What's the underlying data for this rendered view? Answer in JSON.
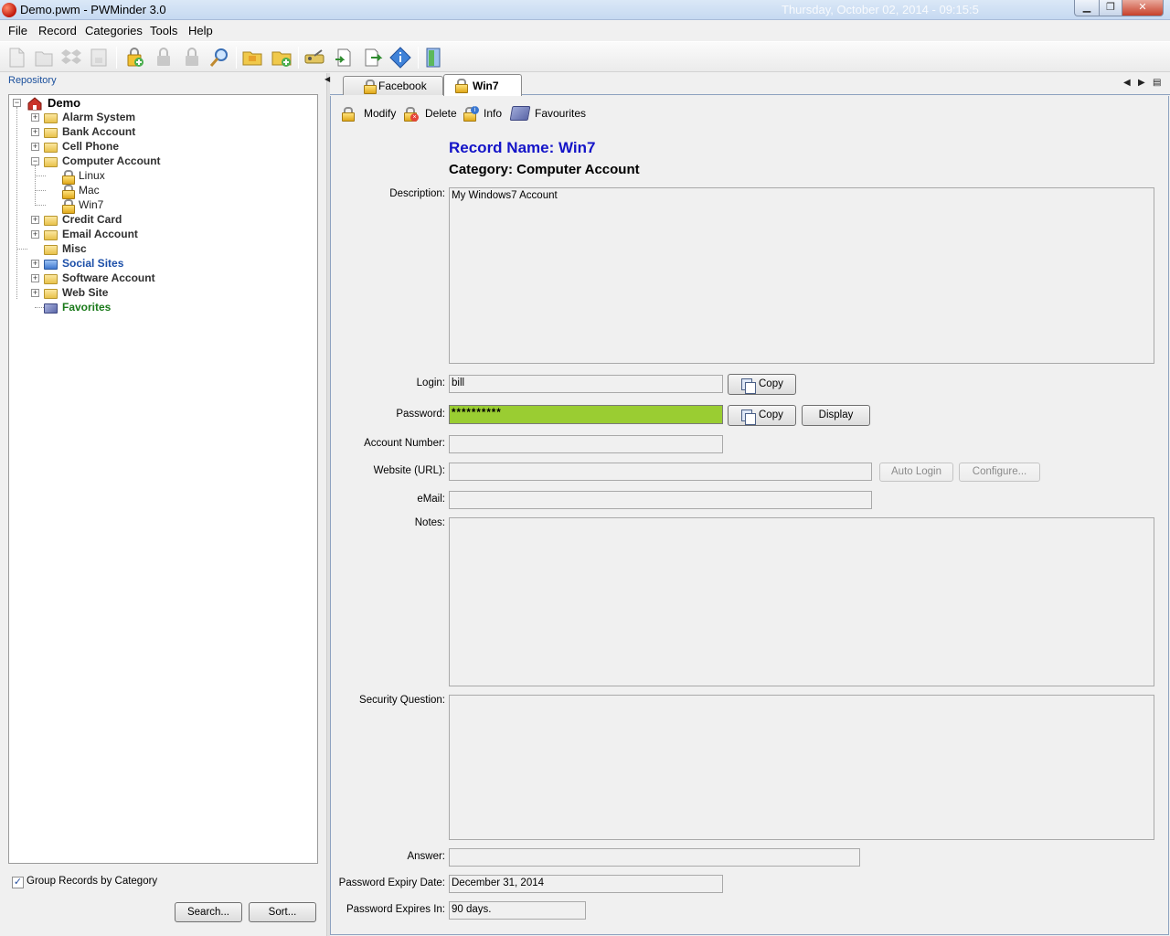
{
  "window": {
    "title": "Demo.pwm - PWMinder 3.0",
    "clock": "Thursday, October 02, 2014 - 09:15:5",
    "controls": {
      "minimize": "▁",
      "maximize": "❐",
      "close": "✕"
    }
  },
  "menu": [
    "File",
    "Record",
    "Categories",
    "Tools",
    "Help"
  ],
  "toolbar": {
    "icons": [
      "new-file-icon",
      "open-file-icon",
      "dropbox-icon",
      "save-file-icon",
      "add-record-icon",
      "lock-icon",
      "lock-icon",
      "search-icon",
      "folder-icon",
      "add-folder-icon",
      "password-generator-icon",
      "import-icon",
      "export-icon",
      "about-icon",
      "exit-icon"
    ]
  },
  "left": {
    "repository_label": "Repository",
    "tree": {
      "root": "Demo",
      "categories": [
        "Alarm System",
        "Bank Account",
        "Cell Phone",
        "Computer Account",
        "Linux",
        "Mac",
        "Win7",
        "Credit Card",
        "Email Account",
        "Misc",
        "Social Sites",
        "Software Account",
        "Web Site",
        "Favorites"
      ]
    },
    "group_checkbox": {
      "checked": true,
      "mark": "✓",
      "label": "Group Records by Category"
    },
    "search_button": "Search...",
    "sort_button": "Sort..."
  },
  "tabs": {
    "items": [
      "Facebook",
      "Win7"
    ],
    "active": "Win7",
    "nav": {
      "prev": "◀",
      "next": "▶",
      "list": "▤"
    }
  },
  "actions": {
    "modify": "Modify",
    "delete": "Delete",
    "info": "Info",
    "favourites": "Favourites",
    "delete_badge": "×",
    "info_badge": "i"
  },
  "record": {
    "name": "Record Name: Win7",
    "category": "Category: Computer Account",
    "labels": {
      "description": "Description:",
      "login": "Login:",
      "password": "Password:",
      "account_number": "Account Number:",
      "website": "Website (URL):",
      "email": "eMail:",
      "notes": "Notes:",
      "security_question": "Security Question:",
      "answer": "Answer:",
      "expiry_date": "Password Expiry Date:",
      "expires_in": "Password Expires In:"
    },
    "values": {
      "description": "My Windows7 Account",
      "login": "bill",
      "password": "**********",
      "account_number": "",
      "website": "",
      "email": "",
      "notes": "",
      "security_question": "",
      "answer": "",
      "expiry_date": "December 31, 2014",
      "expires_in": "90 days."
    },
    "buttons": {
      "copy_login": "Copy",
      "copy_password": "Copy",
      "display": "Display",
      "auto_login": "Auto Login",
      "configure": "Configure..."
    }
  },
  "colors": {
    "record_name": "#1414c8",
    "password_field": "#9acd32",
    "social_sites_label": "#1c4fa8",
    "favorites_label": "#1a7a1a",
    "repository_label": "#1a4f9c"
  }
}
